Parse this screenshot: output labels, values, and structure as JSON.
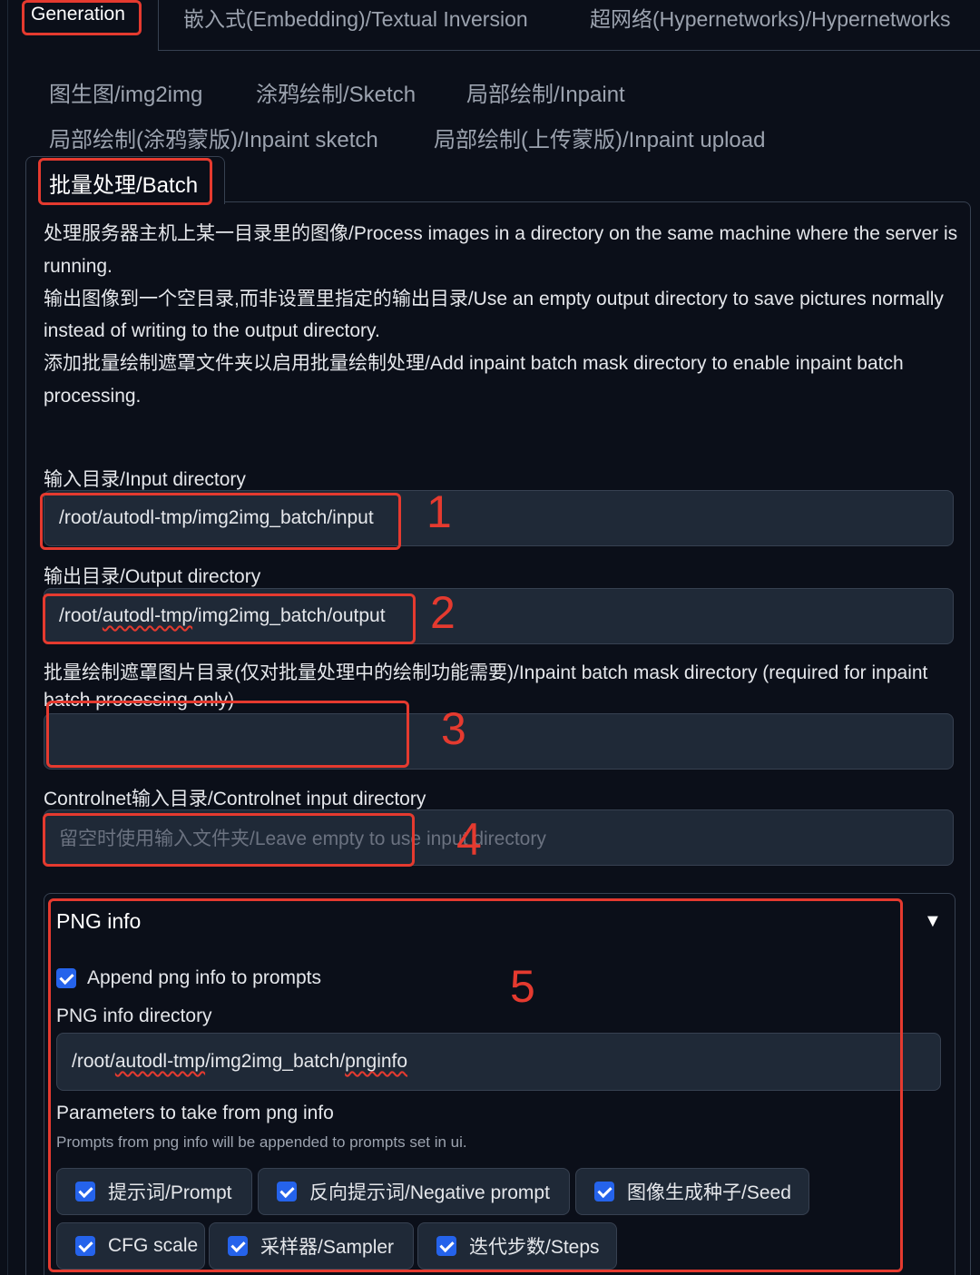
{
  "top_tabs": {
    "generation": "Generation",
    "embedding": "嵌入式(Embedding)/Textual Inversion",
    "hypernetworks": "超网络(Hypernetworks)/Hypernetworks"
  },
  "img2img_tabs": {
    "img2img": "图生图/img2img",
    "sketch": "涂鸦绘制/Sketch",
    "inpaint": "局部绘制/Inpaint",
    "inpaint_sketch": "局部绘制(涂鸦蒙版)/Inpaint sketch",
    "inpaint_upload": "局部绘制(上传蒙版)/Inpaint upload",
    "batch": "批量处理/Batch"
  },
  "description": {
    "line1": "处理服务器主机上某一目录里的图像/Process images in a directory on the same machine where the server is running.",
    "line2": "输出图像到一个空目录,而非设置里指定的输出目录/Use an empty output directory to save pictures normally instead of writing to the output directory.",
    "line3": "添加批量绘制遮罩文件夹以启用批量绘制处理/Add inpaint batch mask directory to enable inpaint batch processing."
  },
  "fields": {
    "input_dir": {
      "label": "输入目录/Input directory",
      "value": "/root/autodl-tmp/img2img_batch/input"
    },
    "output_dir": {
      "label": "输出目录/Output directory",
      "value_prefix": "/root/",
      "value_mark": "autodl-tmp",
      "value_suffix": "/img2img_batch/output"
    },
    "mask_dir": {
      "label": "批量绘制遮罩图片目录(仅对批量处理中的绘制功能需要)/Inpaint batch mask directory (required for inpaint batch processing only)",
      "value": ""
    },
    "controlnet_dir": {
      "label": "Controlnet输入目录/Controlnet input directory",
      "placeholder": "留空时使用输入文件夹/Leave empty to use input directory"
    }
  },
  "annotations": {
    "n1": "1",
    "n2": "2",
    "n3": "3",
    "n4": "4",
    "n5": "5"
  },
  "png_info": {
    "title": "PNG info",
    "arrow": "▼",
    "append_label": "Append png info to prompts",
    "append_checked": true,
    "dir_label": "PNG info directory",
    "dir_prefix": "/root/",
    "dir_mark1": "autodl-tmp",
    "dir_middle": "/img2img_batch/",
    "dir_mark2": "pnginfo",
    "params_label": "Parameters to take from png info",
    "params_help": "Prompts from png info will be appended to prompts set in ui.",
    "params": [
      {
        "label": "提示词/Prompt",
        "checked": true
      },
      {
        "label": "反向提示词/Negative prompt",
        "checked": true
      },
      {
        "label": "图像生成种子/Seed",
        "checked": true
      },
      {
        "label": "CFG scale",
        "checked": true
      },
      {
        "label": "采样器/Sampler",
        "checked": true
      },
      {
        "label": "迭代步数/Steps",
        "checked": true
      }
    ]
  },
  "colors": {
    "background": "#0b0f19",
    "input_bg": "#1f2937",
    "border": "#374151",
    "annotation_red": "#e53a2f",
    "checkbox_blue": "#2563eb"
  }
}
